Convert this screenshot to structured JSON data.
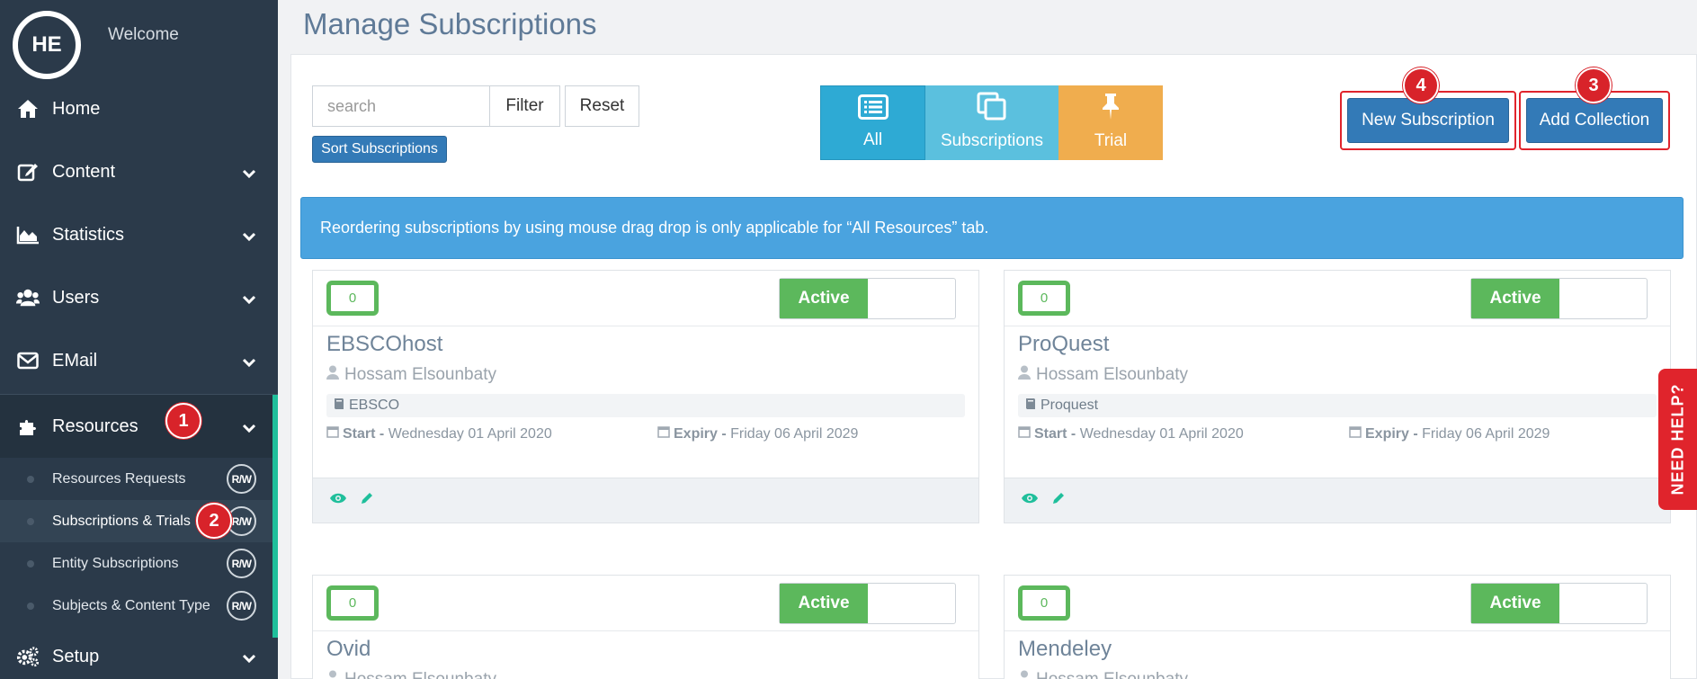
{
  "user": {
    "initials": "HE",
    "welcome": "Welcome"
  },
  "nav": {
    "home": "Home",
    "content": "Content",
    "statistics": "Statistics",
    "users": "Users",
    "email": "EMail",
    "resources": "Resources",
    "setup": "Setup"
  },
  "resources_sub": [
    {
      "label": "Resources Requests",
      "perm": "R/W"
    },
    {
      "label": "Subscriptions & Trials",
      "perm": "R/W"
    },
    {
      "label": "Entity Subscriptions",
      "perm": "R/W"
    },
    {
      "label": "Subjects & Content Type",
      "perm": "R/W"
    }
  ],
  "callouts": {
    "resources": "1",
    "subscriptions": "2",
    "add_collection": "3",
    "new_subscription": "4"
  },
  "page": {
    "title": "Manage Subscriptions"
  },
  "toolbar": {
    "search_placeholder": "search",
    "filter": "Filter",
    "reset": "Reset",
    "sort": "Sort Subscriptions",
    "new_subscription": "New Subscription",
    "add_collection": "Add Collection"
  },
  "tabs": {
    "all": "All",
    "subscriptions": "Subscriptions",
    "trial": "Trial"
  },
  "info": "Reordering subscriptions by using mouse drag drop is only applicable for “All Resources” tab.",
  "cards": [
    {
      "count": "0",
      "status": "Active",
      "name": "EBSCOhost",
      "owner": "Hossam Elsounbaty",
      "collection": "EBSCO",
      "start_label": "Start -",
      "start": "Wednesday 01 April 2020",
      "expiry_label": "Expiry -",
      "expiry": "Friday 06 April 2029"
    },
    {
      "count": "0",
      "status": "Active",
      "name": "ProQuest",
      "owner": "Hossam Elsounbaty",
      "collection": "Proquest",
      "start_label": "Start -",
      "start": "Wednesday 01 April 2020",
      "expiry_label": "Expiry -",
      "expiry": "Friday 06 April 2029"
    },
    {
      "count": "0",
      "status": "Active",
      "name": "Ovid",
      "owner": "Hossam Elsounbaty"
    },
    {
      "count": "0",
      "status": "Active",
      "name": "Mendeley",
      "owner": "Hossam Elsounbaty"
    }
  ],
  "help": "NEED HELP?",
  "colors": {
    "sidebar": "#2b3a4a",
    "accent": "#1fbf9b",
    "primary": "#337ab7",
    "all_tab": "#2eaad4",
    "subs_tab": "#5bc0de",
    "trial_tab": "#f0ad4e",
    "active": "#5cb85c",
    "callout": "#d8232a"
  }
}
